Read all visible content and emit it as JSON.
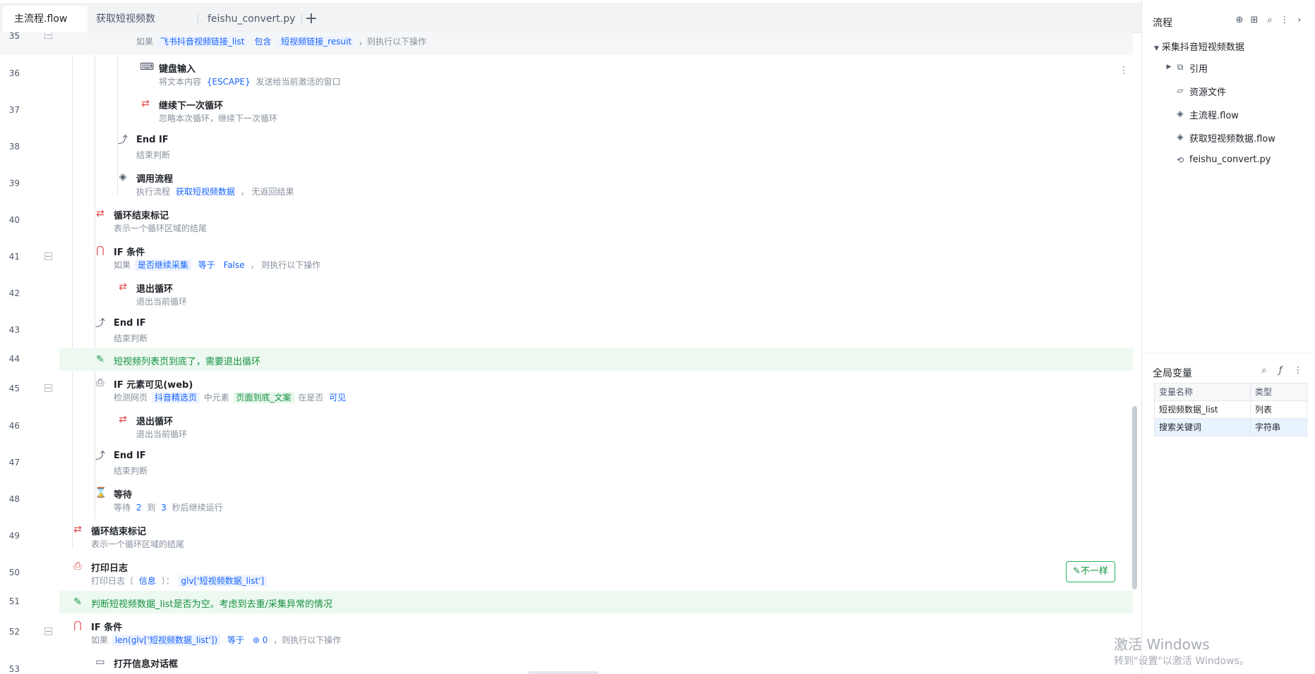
{
  "tabs": [
    {
      "label": "主流程.flow",
      "active": true
    },
    {
      "label": "获取短视频数据.flow",
      "active": false
    },
    {
      "label": "feishu_convert.py",
      "active": false
    }
  ],
  "add_tab_symbol": "+",
  "colors": {
    "accent": "#1664ff",
    "comment_bg": "#edf9f0",
    "comment_text": "#15913f",
    "selected": "#e8f3ff"
  },
  "lines": {
    "l35": {
      "num": "35",
      "d1": "如果",
      "c1": "飞书抖音视频链接_list",
      "d2": "包含",
      "c2": "短视频链接_resuit",
      "d3": "，则执行以下操作"
    },
    "l36": {
      "num": "36",
      "title": "键盘输入",
      "d1": "将文本内容",
      "c1": "{ESCAPE}",
      "d2": "发送给当前激活的窗口"
    },
    "l37": {
      "num": "37",
      "title": "继续下一次循环",
      "d1": "忽略本次循环，继续下一次循环"
    },
    "l38": {
      "num": "38",
      "title": "End IF",
      "d1": "结束判断"
    },
    "l39": {
      "num": "39",
      "title": "调用流程",
      "d1": "执行流程",
      "c1": "获取短视频数据",
      "d2": "，  无返回结果"
    },
    "l40": {
      "num": "40",
      "title": "循环结束标记",
      "d1": "表示一个循环区域的结尾"
    },
    "l41": {
      "num": "41",
      "title": "IF 条件",
      "d1": "如果",
      "c1": "是否继续采集",
      "c2": "等于",
      "c3": "False",
      "d2": "，  则执行以下操作"
    },
    "l42": {
      "num": "42",
      "title": "退出循环",
      "d1": "退出当前循环"
    },
    "l43": {
      "num": "43",
      "title": "End IF",
      "d1": "结束判断"
    },
    "l44": {
      "num": "44",
      "text": "短视频列表页到底了，需要退出循环"
    },
    "l45": {
      "num": "45",
      "title": "IF 元素可见(web)",
      "d1": "检测网页",
      "c1": "抖音精选页",
      "d2": "中元素",
      "c2": "页面到底_文案",
      "d3": "在是否",
      "c3": "可见"
    },
    "l46": {
      "num": "46",
      "title": "退出循环",
      "d1": "退出当前循环"
    },
    "l47": {
      "num": "47",
      "title": "End IF",
      "d1": "结束判断"
    },
    "l48": {
      "num": "48",
      "title": "等待",
      "d1": "等待",
      "c1": "2",
      "d2": "到",
      "c2": "3",
      "d3": "秒后继续运行"
    },
    "l49": {
      "num": "49",
      "title": "循环结束标记",
      "d1": "表示一个循环区域的结尾"
    },
    "l50": {
      "num": "50",
      "title": "打印日志",
      "d1": "打印日志（",
      "c1": "信息",
      "d2": "）：",
      "c2": "glv['短视频数据_list']"
    },
    "l51": {
      "num": "51",
      "text": "判断短视频数据_list是否为空。考虑到去重/采集异常的情况"
    },
    "l52": {
      "num": "52",
      "title": "IF 条件",
      "d1": "如果",
      "c1": "len(glv['短视频数据_list'])",
      "c2": "等于",
      "c3": "⊛ 0",
      "d2": "，则执行以下操作"
    },
    "l53": {
      "num": "53",
      "title": "打开信息对话框"
    }
  },
  "diff_button": "不一样",
  "watermark": {
    "line1": "激活 Windows",
    "line2": "转到\"设置\"以激活 Windows。"
  },
  "flow_panel": {
    "title": "流程",
    "root": "采集抖音短视频数据",
    "items": [
      "引用",
      "资源文件",
      "主流程.flow",
      "获取短视频数据.flow",
      "feishu_convert.py"
    ]
  },
  "vars_panel": {
    "title": "全局变量",
    "headers": [
      "变量名称",
      "类型"
    ],
    "rows": [
      {
        "name": "短视频数据_list",
        "type": "列表"
      },
      {
        "name": "搜索关键词",
        "type": "字符串"
      }
    ]
  }
}
